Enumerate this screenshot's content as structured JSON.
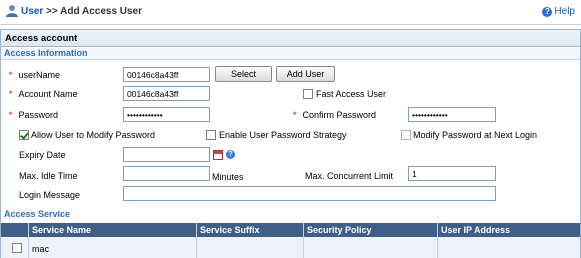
{
  "header": {
    "crumb_link": "User",
    "crumb_sep": " >> ",
    "crumb_current": "Add Access User",
    "help_label": "Help"
  },
  "panel": {
    "title": "Access account",
    "access_info_title": "Access Information",
    "access_service_title": "Access Service"
  },
  "form": {
    "username_label": "userName",
    "username_value": "00146c8a43ff",
    "select_button": "Select",
    "add_user_button": "Add User",
    "account_name_label": "Account Name",
    "account_name_value": "00146c8a43ff",
    "fast_access_label": "Fast Access User",
    "fast_access_checked": false,
    "password_label": "Password",
    "password_value": "••••••••••••",
    "confirm_password_label": "Confirm Password",
    "confirm_password_value": "••••••••••••",
    "allow_modify_label": "Allow User to Modify Password",
    "allow_modify_checked": true,
    "enable_strategy_label": "Enable User Password Strategy",
    "enable_strategy_checked": false,
    "modify_next_login_label": "Modify Password at Next Login",
    "modify_next_login_checked": false,
    "expiry_date_label": "Expiry Date",
    "expiry_date_value": "",
    "max_idle_label": "Max. Idle Time",
    "max_idle_value": "",
    "minutes_label": "Minutes",
    "max_concurrent_label": "Max. Concurrent Limit",
    "max_concurrent_value": "1",
    "login_message_label": "Login Message",
    "login_message_value": "",
    "required_mark": "*"
  },
  "service_table": {
    "headers": [
      "Service Name",
      "Service Suffix",
      "Security Policy",
      "User IP Address"
    ],
    "rows": [
      {
        "checked": false,
        "service_name": "mac",
        "service_suffix": "",
        "security_policy": "",
        "user_ip": ""
      }
    ]
  },
  "colors": {
    "link": "#1a56b0",
    "table_header": "#3f5f88",
    "section_title": "#2e6fb5",
    "required": "#cc0000"
  },
  "icons": {
    "user": "user-icon",
    "help": "help-icon",
    "calendar": "calendar-icon",
    "question": "question-icon"
  }
}
